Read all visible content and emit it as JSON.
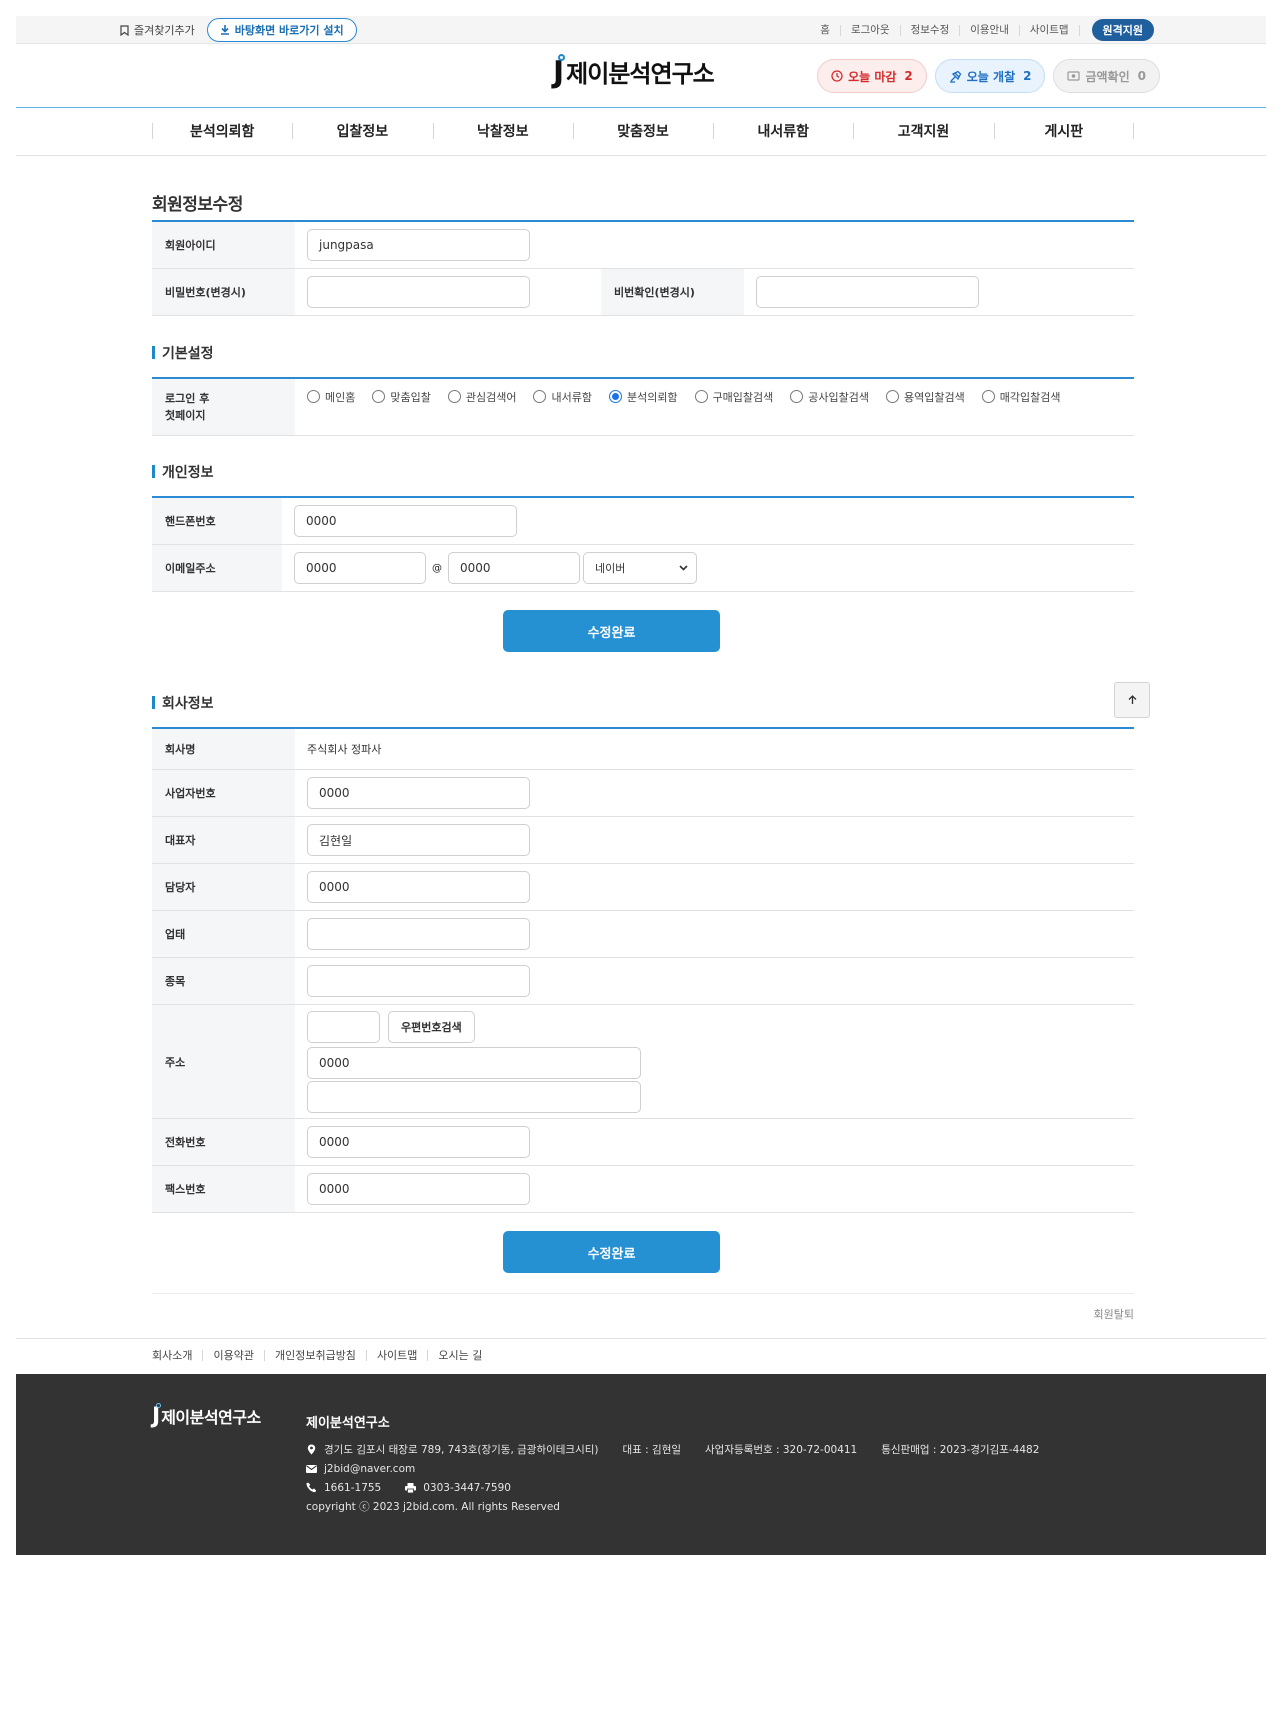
{
  "util": {
    "favorite": "즐겨찾기추가",
    "install": "바탕화면 바로가기 설치",
    "links": [
      "홈",
      "로그아웃",
      "정보수정",
      "이용안내",
      "사이트맵"
    ],
    "remote": "원격지원"
  },
  "brand": {
    "logo_j": "J",
    "logo_text": "제이분석연구소"
  },
  "pills": {
    "deadline": {
      "label": "오늘 마감",
      "count": "2"
    },
    "opening": {
      "label": "오늘 개찰",
      "count": "2"
    },
    "amount": {
      "label": "금액확인",
      "count": "0"
    }
  },
  "gnb": [
    "분석의뢰함",
    "입찰정보",
    "낙찰정보",
    "맞춤정보",
    "내서류함",
    "고객지원",
    "게시판"
  ],
  "page_title": "회원정보수정",
  "account": {
    "id_label": "회원아이디",
    "id_value": "jungpasa",
    "pw_label": "비밀번호(변경시)",
    "pw_confirm_label": "비번확인(변경시)"
  },
  "basic": {
    "title": "기본설정",
    "first_page_label": "로그인 후 첫페이지",
    "options": [
      "메인홈",
      "맞춤입찰",
      "관심검색어",
      "내서류함",
      "분석의뢰함",
      "구매입찰검색",
      "공사입찰검색",
      "용역입찰검색",
      "매각입찰검색"
    ],
    "selected": "분석의뢰함"
  },
  "personal": {
    "title": "개인정보",
    "phone_label": "핸드폰번호",
    "phone_value": "0000",
    "email_label": "이메일주소",
    "email_id": "0000",
    "at": "@",
    "email_domain": "0000",
    "email_select": "네이버"
  },
  "submit_label": "수정완료",
  "company": {
    "title": "회사정보",
    "name_label": "회사명",
    "name_value": "주식회사 정파사",
    "biz_no_label": "사업자번호",
    "biz_no_value": "0000",
    "ceo_label": "대표자",
    "ceo_value": "김현일",
    "manager_label": "담당자",
    "manager_value": "0000",
    "biz_type_label": "업태",
    "biz_type_value": "",
    "biz_item_label": "종목",
    "biz_item_value": "",
    "address_label": "주소",
    "zip_value": "",
    "zip_search": "우편번호검색",
    "address1": "0000",
    "address2": "",
    "tel_label": "전화번호",
    "tel_value": "0000",
    "fax_label": "팩스번호",
    "fax_value": "0000"
  },
  "withdraw": "회원탈퇴",
  "footer_links": [
    "회사소개",
    "이용약관",
    "개인정보취급방침",
    "사이트맵",
    "오시는 길"
  ],
  "footer": {
    "name": "제이분석연구소",
    "address": "경기도 김포시 태장로 789, 743호(장기동, 금광하이테크시티)",
    "ceo": "대표 : 김현일",
    "biz_no": "사업자등록번호 : 320-72-00411",
    "mail_order": "통신판매업 : 2023-경기김포-4482",
    "email": "j2bid@naver.com",
    "tel": "1661-1755",
    "fax": "0303-3447-7590",
    "copyright": "copyright ⓒ 2023 j2bid.com. All rights Reserved"
  },
  "colors": {
    "accent": "#2590d2",
    "footer_bg": "#333333",
    "remote_btn": "#1f5f9e"
  }
}
